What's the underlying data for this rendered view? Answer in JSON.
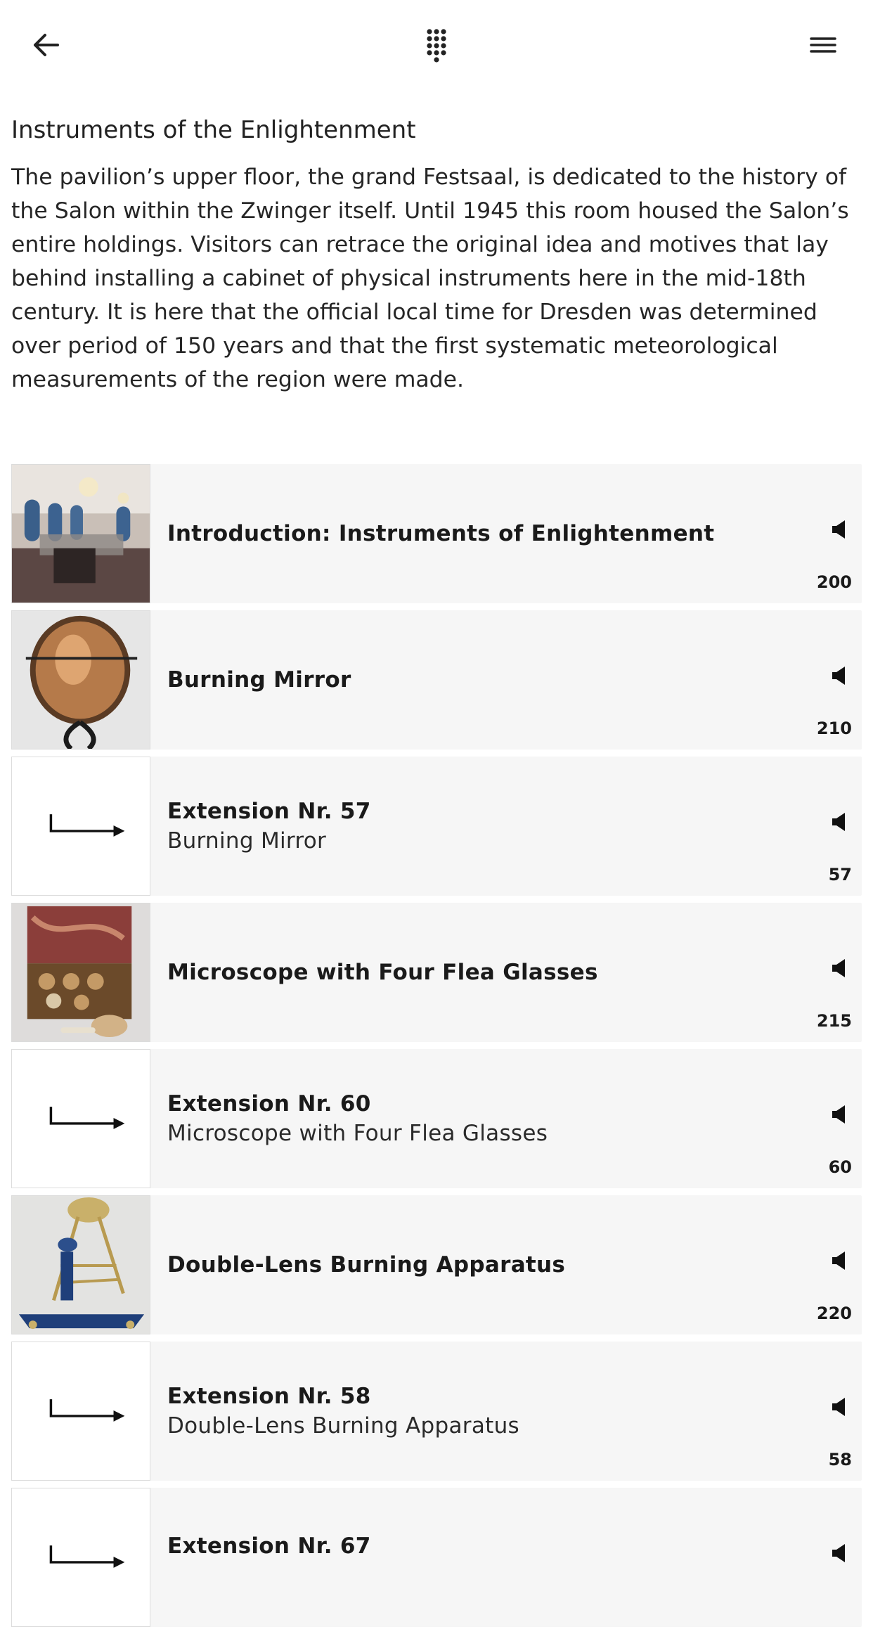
{
  "header": {
    "back_icon": "arrow-left-icon",
    "keypad_icon": "numeric-keypad-icon",
    "menu_icon": "hamburger-menu-icon"
  },
  "page": {
    "title": "Instruments of the Enlightenment",
    "description": "The pavilion’s upper floor, the grand Festsaal, is dedicated to the history of the Salon within the Zwinger itself. Until 1945 this room housed the Salon’s entire holdings. Visitors can retrace the original idea and motives that lay behind installing a cabinet of physical instruments here in the mid-18th century. It is here that the official local time for Dresden was determined over period of 150 years and that the first systematic meteorological measurements of the region were made."
  },
  "stops": [
    {
      "title": "Introduction: Instruments of Enlightenment",
      "subtitle": "",
      "number": "200",
      "thumbnail": "gallery-hall-photo",
      "audio_icon": "speaker-icon"
    },
    {
      "title": "Burning Mirror",
      "subtitle": "",
      "number": "210",
      "thumbnail": "burning-mirror-photo",
      "audio_icon": "speaker-icon"
    },
    {
      "title": "Extension Nr. 57",
      "subtitle": "Burning Mirror",
      "number": "57",
      "thumbnail": "extension-arrow-icon",
      "audio_icon": "speaker-icon"
    },
    {
      "title": "Microscope with Four Flea Glasses",
      "subtitle": "",
      "number": "215",
      "thumbnail": "microscope-case-photo",
      "audio_icon": "speaker-icon"
    },
    {
      "title": "Extension Nr. 60",
      "subtitle": "Microscope with Four Flea Glasses",
      "number": "60",
      "thumbnail": "extension-arrow-icon",
      "audio_icon": "speaker-icon"
    },
    {
      "title": "Double-Lens Burning Apparatus",
      "subtitle": "",
      "number": "220",
      "thumbnail": "burning-apparatus-photo",
      "audio_icon": "speaker-icon"
    },
    {
      "title": "Extension Nr. 58",
      "subtitle": "Double-Lens Burning Apparatus",
      "number": "58",
      "thumbnail": "extension-arrow-icon",
      "audio_icon": "speaker-icon"
    },
    {
      "title": "Extension Nr. 67",
      "subtitle": "",
      "number": "",
      "thumbnail": "extension-arrow-icon",
      "audio_icon": "speaker-icon"
    }
  ]
}
